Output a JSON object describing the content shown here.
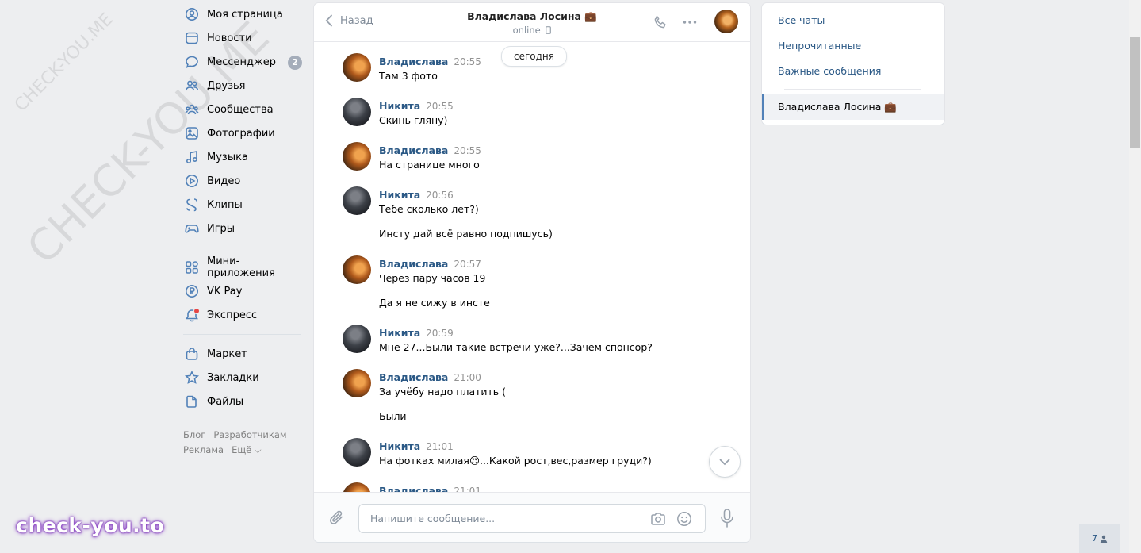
{
  "watermarks": {
    "small": "CHECK-YOU.ME",
    "large": "CHECK-YOU.ME",
    "bottom": "check-you.to"
  },
  "leftnav": {
    "items": [
      {
        "label": "Моя страница",
        "icon": "user-circle-icon"
      },
      {
        "label": "Новости",
        "icon": "news-icon"
      },
      {
        "label": "Мессенджер",
        "icon": "message-icon",
        "badge": "2"
      },
      {
        "label": "Друзья",
        "icon": "friends-icon"
      },
      {
        "label": "Сообщества",
        "icon": "communities-icon"
      },
      {
        "label": "Фотографии",
        "icon": "photo-icon"
      },
      {
        "label": "Музыка",
        "icon": "music-icon"
      },
      {
        "label": "Видео",
        "icon": "video-icon"
      },
      {
        "label": "Клипы",
        "icon": "clips-icon"
      },
      {
        "label": "Игры",
        "icon": "games-icon"
      }
    ],
    "items2": [
      {
        "label": "Мини-приложения",
        "icon": "apps-icon"
      },
      {
        "label": "VK Pay",
        "icon": "vkpay-icon"
      },
      {
        "label": "Экспресс",
        "icon": "express-icon"
      }
    ],
    "items3": [
      {
        "label": "Маркет",
        "icon": "market-icon"
      },
      {
        "label": "Закладки",
        "icon": "bookmark-icon"
      },
      {
        "label": "Файлы",
        "icon": "files-icon"
      }
    ],
    "footer": {
      "blog": "Блог",
      "developers": "Разработчикам",
      "ads": "Реклама",
      "more": "Ещё ⌵"
    }
  },
  "chat": {
    "back_label": "Назад",
    "title": "Владислава Лосина 💼",
    "status": "online",
    "date_pill": "сегодня",
    "messages": [
      {
        "author": "Владислава",
        "time": "20:55",
        "texts": [
          "Там 3 фото"
        ]
      },
      {
        "author": "Никита",
        "time": "20:55",
        "texts": [
          "Скинь гляну)"
        ]
      },
      {
        "author": "Владислава",
        "time": "20:55",
        "texts": [
          "На странице много"
        ]
      },
      {
        "author": "Никита",
        "time": "20:56",
        "texts": [
          "Тебе сколько лет?)",
          "Инсту дай всё равно подпишусь)"
        ]
      },
      {
        "author": "Владислава",
        "time": "20:57",
        "texts": [
          "Через пару часов 19",
          "Да я не сижу в инсте"
        ]
      },
      {
        "author": "Никита",
        "time": "20:59",
        "texts": [
          "Мне 27...Были такие встречи уже?...Зачем спонсор?"
        ]
      },
      {
        "author": "Владислава",
        "time": "21:00",
        "texts": [
          "За учёбу надо платить (",
          "Были"
        ]
      },
      {
        "author": "Никита",
        "time": "21:01",
        "texts": [
          "На фотках милая😍...Какой рост,вес,размер груди?)"
        ]
      },
      {
        "author": "Владислава",
        "time": "21:01",
        "texts": []
      }
    ],
    "composer": {
      "placeholder": "Напишите сообщение..."
    }
  },
  "rightnav": {
    "all": "Все чаты",
    "unread": "Непрочитанные",
    "important": "Важные сообщения",
    "active_chat": "Владислава Лосина 💼"
  },
  "online_count": "7"
}
